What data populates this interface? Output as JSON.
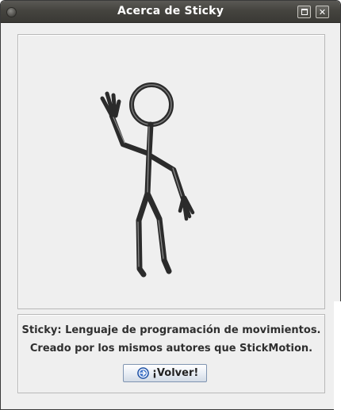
{
  "window": {
    "title": "Acerca de Sticky",
    "buttons": [
      "maximize",
      "close"
    ]
  },
  "about": {
    "description_line1": "Sticky: Lenguaje de programación de movimientos.",
    "description_line2": "Creado por los mismos autores que StickMotion."
  },
  "back_button": {
    "label": "¡Volver!",
    "icon": "arrow-right-circle-icon"
  },
  "colors": {
    "titlebar": "#45443f",
    "window_bg": "#efefef",
    "button_border": "#7f94b1",
    "figure": "#2b2b2b",
    "icon_blue": "#3f73c9"
  }
}
